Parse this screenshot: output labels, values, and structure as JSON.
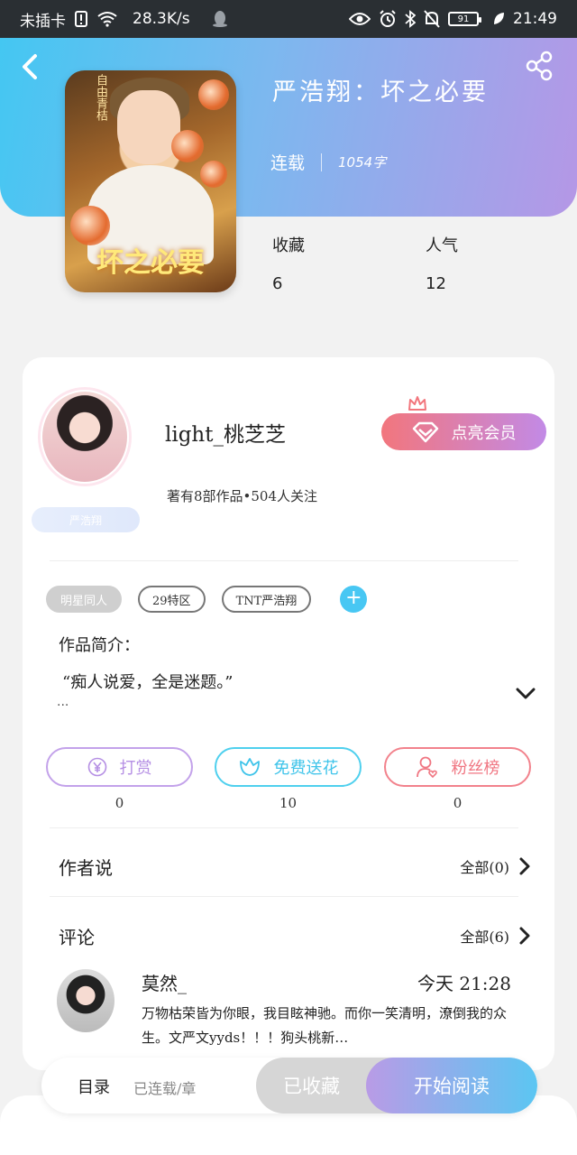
{
  "status_bar": {
    "carrier": "未插卡",
    "speed": "28.3K/s",
    "battery": "91",
    "time": "21:49"
  },
  "book": {
    "title": "严浩翔：坏之必要",
    "status": "连载",
    "word_count": "1054字",
    "cover_title": "坏之必要",
    "cover_side_text": "自由青桔"
  },
  "stats": {
    "favorites_label": "收藏",
    "favorites_value": "6",
    "popularity_label": "人气",
    "popularity_value": "12"
  },
  "author": {
    "name": "light_桃芝芝",
    "summary": "著有8部作品•504人关注",
    "tagline": "严浩翔",
    "vip_button_label": "点亮会员"
  },
  "tags": [
    "明星同人",
    "29特区",
    "TNT严浩翔"
  ],
  "intro": {
    "label": "作品简介：",
    "text": "“痴人说爱，全是迷题。”",
    "ellipsis": "..."
  },
  "actions": {
    "tip_label": "打赏",
    "tip_count": "0",
    "flower_label": "免费送花",
    "flower_count": "10",
    "fans_label": "粉丝榜",
    "fans_count": "0"
  },
  "author_says": {
    "title": "作者说",
    "more": "全部(0)"
  },
  "comments": {
    "title": "评论",
    "more": "全部(6)",
    "items": [
      {
        "user": "莫然_",
        "time": "今天 21:28",
        "text": "万物枯荣皆为你眼，我目眩神驰。而你一笑清明，潦倒我的众生。文严文yyds！！！狗头桃新…"
      }
    ]
  },
  "bottom_bar": {
    "toc_label": "目录",
    "toc_sub": "已连载/章",
    "collected_label": "已收藏",
    "read_label": "开始阅读"
  },
  "colors": {
    "accent_blue": "#48c7f3",
    "accent_purple": "#b597e6",
    "tip_border": "#c3a2ea",
    "flower_border": "#4fd0ee",
    "fans_border": "#f2828c"
  }
}
